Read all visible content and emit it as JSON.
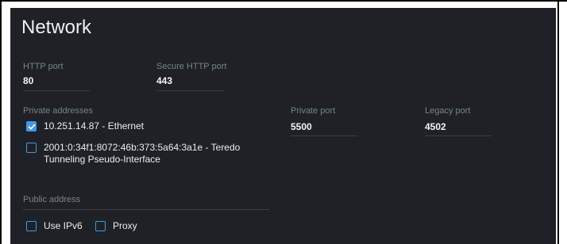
{
  "page": {
    "title": "Network"
  },
  "http": {
    "label": "HTTP port",
    "value": "80"
  },
  "https": {
    "label": "Secure HTTP port",
    "value": "443"
  },
  "private_addresses": {
    "label": "Private addresses",
    "items": [
      {
        "text": "10.251.14.87 - Ethernet",
        "checked": true
      },
      {
        "text": "2001:0:34f1:8072:46b:373:5a64:3a1e - Teredo Tunneling Pseudo-Interface",
        "checked": false
      }
    ]
  },
  "private_port": {
    "label": "Private port",
    "value": "5500"
  },
  "legacy_port": {
    "label": "Legacy port",
    "value": "4502"
  },
  "public_address": {
    "label": "Public address"
  },
  "options": {
    "use_ipv6": {
      "label": "Use IPv6",
      "checked": false
    },
    "proxy": {
      "label": "Proxy",
      "checked": false
    }
  },
  "colors": {
    "panel_bg": "#1e2125",
    "accent": "#3f9ae8",
    "label": "#7c838c"
  },
  "icons": {
    "checked": "checkmark-icon"
  }
}
